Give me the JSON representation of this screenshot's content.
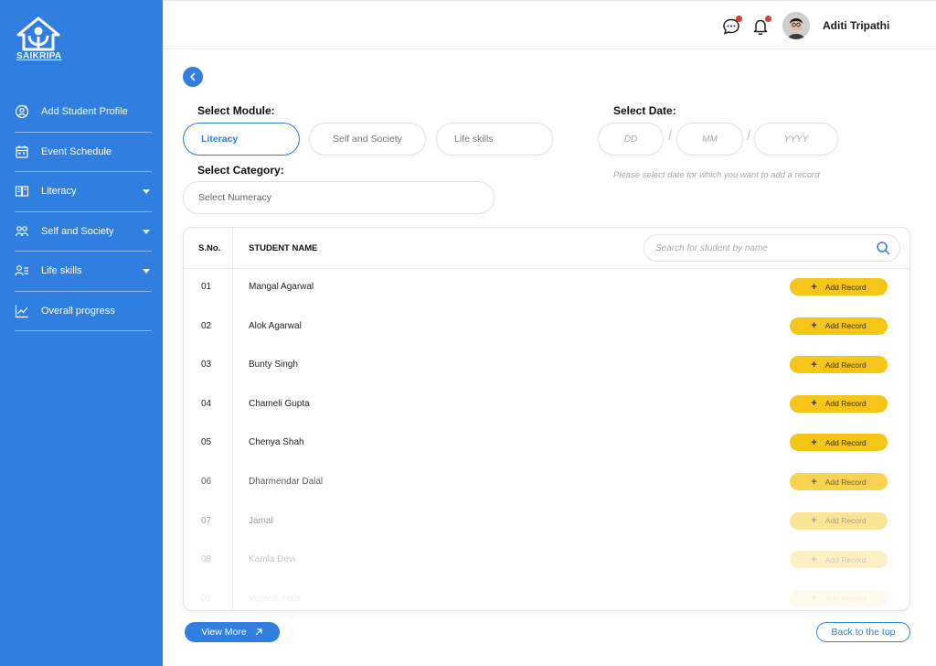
{
  "brand": {
    "name": "SAIKRIPA"
  },
  "sidebar": {
    "items": [
      {
        "label": "Add Student Profile",
        "icon": "user-add-icon",
        "has_caret": false
      },
      {
        "label": "Event Schedule",
        "icon": "calendar-icon",
        "has_caret": false
      },
      {
        "label": "Literacy",
        "icon": "book-icon",
        "has_caret": true
      },
      {
        "label": "Self and Society",
        "icon": "group-icon",
        "has_caret": true
      },
      {
        "label": "Life skills",
        "icon": "user-list-icon",
        "has_caret": true
      },
      {
        "label": "Overall progress",
        "icon": "chart-line-icon",
        "has_caret": false
      }
    ]
  },
  "header": {
    "user_name": "Aditi Tripathi",
    "chat_icon": "chat-icon",
    "bell_icon": "bell-icon"
  },
  "module": {
    "label": "Select Module:",
    "options": [
      "Literacy",
      "Self and Society",
      "Life skills"
    ],
    "selected": "Literacy"
  },
  "category": {
    "label": "Select Category:",
    "placeholder": "Select Numeracy"
  },
  "date": {
    "label": "Select Date:",
    "dd": "DD",
    "mm": "MM",
    "yyyy": "YYYY",
    "hint": "Please select date for which you want to add a record"
  },
  "table": {
    "col_sno": "S.No.",
    "col_name": "STUDENT NAME",
    "search_placeholder": "Search for student by name",
    "add_label": "Add Record",
    "rows": [
      {
        "sno": "01",
        "name": "Mangal Agarwal",
        "opacity": 1
      },
      {
        "sno": "02",
        "name": "Alok Agarwal",
        "opacity": 1
      },
      {
        "sno": "03",
        "name": "Bunty Singh",
        "opacity": 1
      },
      {
        "sno": "04",
        "name": "Chameli Gupta",
        "opacity": 1
      },
      {
        "sno": "05",
        "name": "Chenya Shah",
        "opacity": 1
      },
      {
        "sno": "06",
        "name": "Dharmendar Dalal",
        "opacity": 0.75
      },
      {
        "sno": "07",
        "name": "Jamal",
        "opacity": 0.45
      },
      {
        "sno": "08",
        "name": "Kamla Devi",
        "opacity": 0.25
      },
      {
        "sno": "09",
        "name": "Vaijanti mala",
        "opacity": 0.08
      }
    ]
  },
  "footer": {
    "view_more": "View More",
    "back_top": "Back to the top"
  },
  "colors": {
    "primary": "#2f7ee0",
    "accent": "#f5c518",
    "alert": "#e53935"
  }
}
